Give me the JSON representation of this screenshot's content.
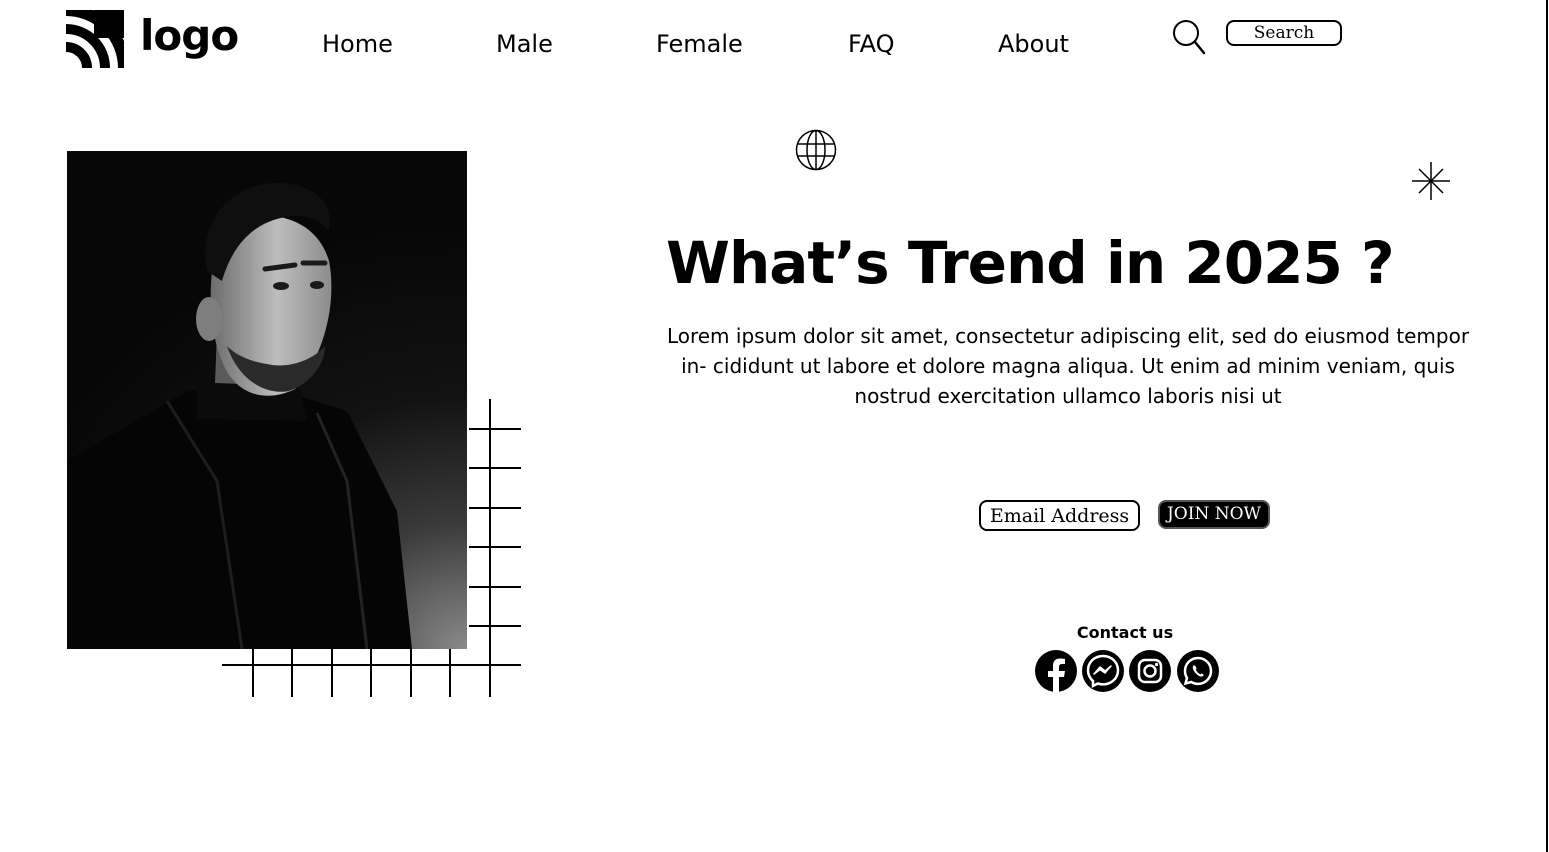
{
  "header": {
    "logo_text": "logo",
    "nav": [
      "Home",
      "Male",
      "Female",
      "FAQ",
      "About"
    ],
    "search_placeholder": "Search"
  },
  "hero": {
    "headline": "What’s Trend in 2025 ?",
    "body": "Lorem ipsum dolor sit amet, consectetur adipiscing elit, sed do eiusmod tempor in- cididunt ut labore et dolore magna aliqua. Ut enim ad minim veniam, quis nostrud exercitation ullamco laboris nisi ut",
    "email_placeholder": "Email Address",
    "join_label": "JOIN NOW"
  },
  "contact": {
    "title": "Contact us",
    "icons": [
      "facebook-icon",
      "messenger-icon",
      "instagram-icon",
      "whatsapp-icon"
    ]
  },
  "decor_icons": [
    "globe-icon",
    "sparkle-icon",
    "search-icon"
  ]
}
